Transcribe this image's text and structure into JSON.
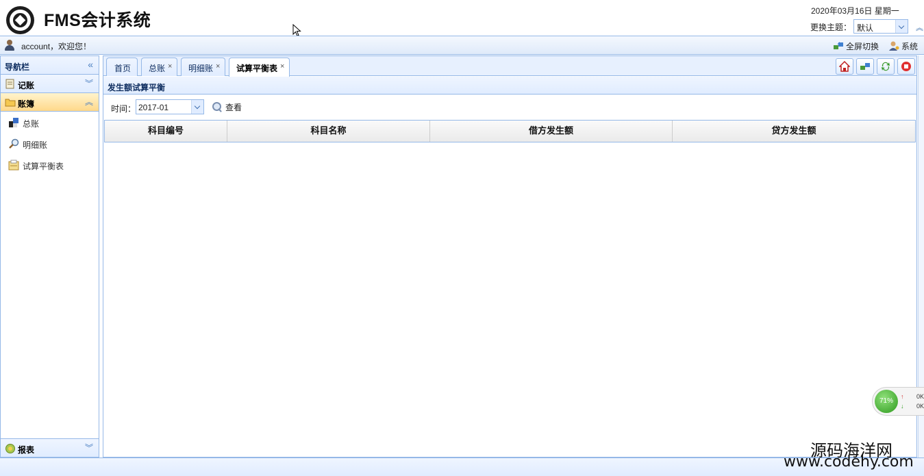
{
  "header": {
    "app_title": "FMS会计系统",
    "date": "2020年03月16日 星期一",
    "theme_label": "更换主题：",
    "theme_value": "默认"
  },
  "userbar": {
    "welcome": "account，欢迎您！",
    "fullscreen": "全屏切换",
    "system": "系统"
  },
  "sidebar": {
    "title": "导航栏",
    "groups": [
      {
        "label": "记账",
        "icon": "ledger-icon",
        "expanded": false
      },
      {
        "label": "账簿",
        "icon": "folder-icon",
        "expanded": true,
        "items": [
          {
            "label": "总账",
            "icon": "general-ledger-icon"
          },
          {
            "label": "明细账",
            "icon": "magnifier-icon"
          },
          {
            "label": "试算平衡表",
            "icon": "balance-sheet-icon"
          }
        ]
      },
      {
        "label": "报表",
        "icon": "report-icon",
        "expanded": false
      }
    ]
  },
  "tabs": [
    {
      "label": "首页",
      "closable": false,
      "active": false
    },
    {
      "label": "总账",
      "closable": true,
      "active": false
    },
    {
      "label": "明细账",
      "closable": true,
      "active": false
    },
    {
      "label": "试算平衡表",
      "closable": true,
      "active": true
    }
  ],
  "tab_close_glyph": "×",
  "panel": {
    "title": "发生额试算平衡",
    "time_label": "时间：",
    "time_value": "2017-01",
    "search_label": "查看"
  },
  "grid": {
    "columns": [
      "科目编号",
      "科目名称",
      "借方发生额",
      "贷方发生额"
    ],
    "rows": []
  },
  "speed_widget": {
    "percent": "71%",
    "upload": "0K",
    "download": "0K"
  },
  "watermark": {
    "line1": "源码海洋网",
    "line2": "www.codehy.com"
  },
  "colors": {
    "border": "#95b8e7",
    "header_bg": "#e0ecff",
    "active_group_bg": "#ffd88a"
  }
}
